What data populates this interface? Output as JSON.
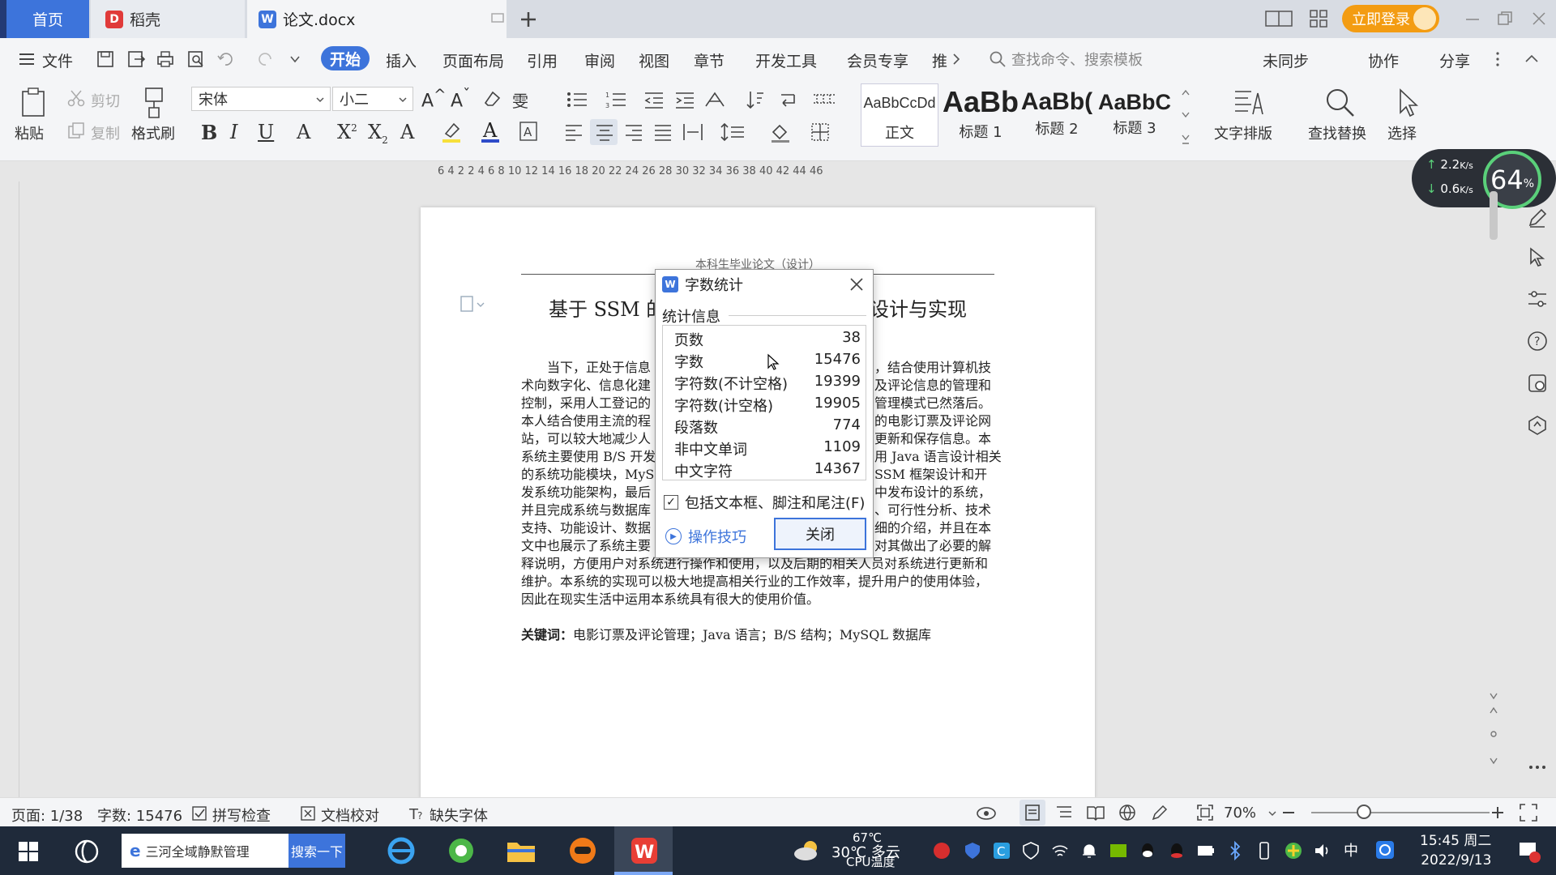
{
  "tabs": {
    "home": "首页",
    "daoke": "稻壳",
    "doc": "论文.docx"
  },
  "header": {
    "login": "立即登录"
  },
  "menu": {
    "file": "文件",
    "items": [
      "开始",
      "插入",
      "页面布局",
      "引用",
      "审阅",
      "视图",
      "章节",
      "开发工具",
      "会员专享",
      "推"
    ],
    "search_placeholder": "查找命令、搜索模板",
    "unsynced": "未同步",
    "collab": "协作",
    "share": "分享"
  },
  "ribbon": {
    "paste": "粘贴",
    "cut": "剪切",
    "copy": "复制",
    "format_painter": "格式刷",
    "font_name": "宋体",
    "font_size": "小二",
    "styles": [
      {
        "preview": "AaBbCcDd",
        "label": "正文"
      },
      {
        "preview": "AaBb",
        "label": "标题 1"
      },
      {
        "preview": "AaBb(",
        "label": "标题 2"
      },
      {
        "preview": "AaBbC",
        "label": "标题 3"
      }
    ],
    "text_layout": "文字排版",
    "find_replace": "查找替换",
    "select": "选择"
  },
  "ruler": {
    "numbers": "6    4    2         2    4    6    8   10   12   14   16   18   20   22   24   26   28   30   32   34   36   38   40   42   44   46"
  },
  "document": {
    "header_text": "本科生毕业论文（设计）",
    "title": "基于 SSM 的",
    "title_right": "设计与实现",
    "abstract_lines": [
      "当下，正处于信息",
      "术向数字化、信息化建",
      "控制，采用人工登记的",
      "本人结合使用主流的程",
      "站，可以较大地减少人",
      "系统主要使用 B/S 开发",
      "的系统功能模块，MyS",
      "发系统功能架构，最后",
      "并且完成系统与数据库",
      "支持、功能设计、数据",
      "文中也展示了系统主要"
    ],
    "abstract_right": [
      "，结合使用计算机技",
      "及评论信息的管理和",
      "管理模式已然落后。",
      "的电影订票及评论网",
      "更新和保存信息。本",
      "用 Java 语言设计相关",
      " SSM 框架设计和开",
      "中发布设计的系统，",
      "、可行性分析、技术",
      "细的介绍，并且在本",
      "对其做出了必要的解"
    ],
    "abstract_tail": "释说明，方便用户对系统进行操作和使用，以及后期的相关人员对系统进行更新和维护。本系统的实现可以极大地提高相关行业的工作效率，提升用户的使用体验，因此在现实生活中运用本系统具有很大的使用价值。",
    "keywords_label": "关键词：",
    "keywords": "电影订票及评论管理；Java 语言；B/S 结构；MySQL 数据库"
  },
  "dialog": {
    "title": "字数统计",
    "section": "统计信息",
    "stats": [
      {
        "label": "页数",
        "value": "38"
      },
      {
        "label": "字数",
        "value": "15476"
      },
      {
        "label": "字符数(不计空格)",
        "value": "19399"
      },
      {
        "label": "字符数(计空格)",
        "value": "19905"
      },
      {
        "label": "段落数",
        "value": "774"
      },
      {
        "label": "非中文单词",
        "value": "1109"
      },
      {
        "label": "中文字符",
        "value": "14367"
      }
    ],
    "include_checkbox": "包括文本框、脚注和尾注(F)",
    "tips": "操作技巧",
    "close": "关闭"
  },
  "speed": {
    "up": "2.2",
    "up_unit": "K/s",
    "down": "0.6",
    "down_unit": "K/s",
    "percent": "64",
    "percent_unit": "%"
  },
  "status": {
    "page": "页面: 1/38",
    "words": "字数: 15476",
    "spell": "拼写检查",
    "proof": "文档校对",
    "missing_font": "缺失字体",
    "zoom": "70%"
  },
  "taskbar": {
    "search_text": "三河全域静默管理",
    "search_btn": "搜索一下",
    "temp": "67℃",
    "cpu": "CPU温度",
    "weather": "30℃ 多云",
    "ime": "中",
    "time": "15:45 周二",
    "date": "2022/9/13"
  },
  "colors": {
    "accent": "#3d74db",
    "login": "#f39c12"
  }
}
